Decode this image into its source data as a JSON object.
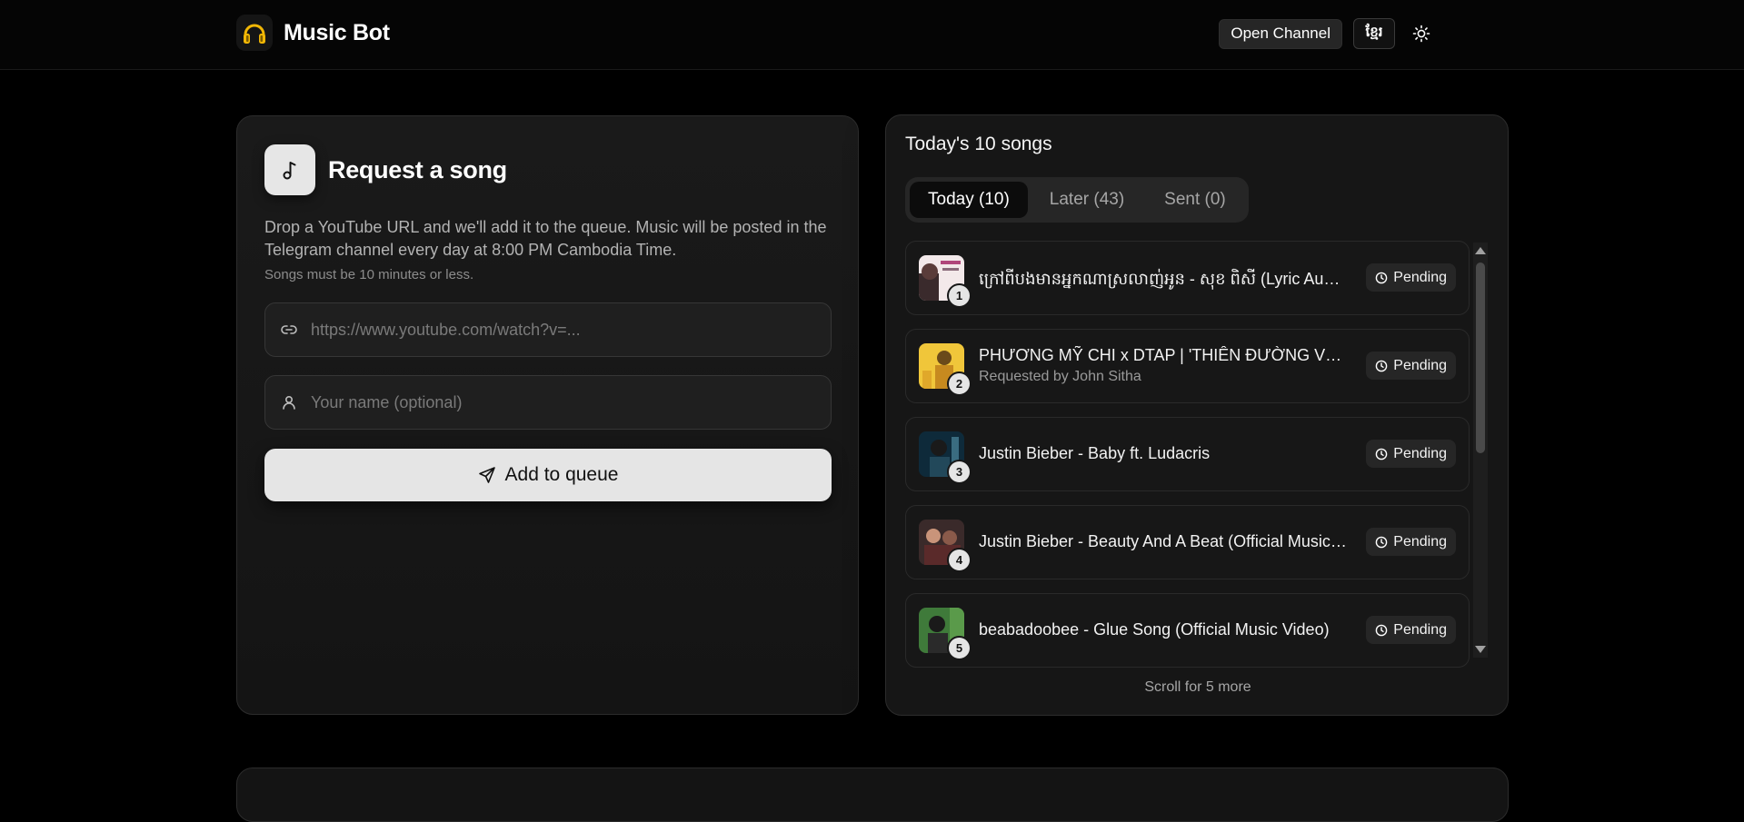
{
  "header": {
    "app_name": "Music Bot",
    "open_channel_label": "Open Channel",
    "language_label": "ខ្មែរ"
  },
  "request": {
    "title": "Request a song",
    "description": "Drop a YouTube URL and we'll add it to the queue. Music will be posted in the Telegram channel every day at 8:00 PM Cambodia Time.",
    "note": "Songs must be 10 minutes or less.",
    "url_placeholder": "https://www.youtube.com/watch?v=...",
    "name_placeholder": "Your name (optional)",
    "submit_label": "Add to queue"
  },
  "queue": {
    "title": "Today's 10 songs",
    "tabs": [
      {
        "label": "Today (10)",
        "active": true
      },
      {
        "label": "Later (43)",
        "active": false
      },
      {
        "label": "Sent (0)",
        "active": false
      }
    ],
    "songs": [
      {
        "num": "1",
        "title": "ក្រៅពីបងមានអ្នកណាស្រលាញ់អូន - សុខ ពិសី (Lyric Audio)",
        "requested_by": "",
        "status": "Pending"
      },
      {
        "num": "2",
        "title": "PHƯƠNG MỸ CHI x DTAP | 'THIÊN ĐƯỜNG VỚI EM'",
        "requested_by": "Requested by John Sitha",
        "status": "Pending"
      },
      {
        "num": "3",
        "title": "Justin Bieber - Baby ft. Ludacris",
        "requested_by": "",
        "status": "Pending"
      },
      {
        "num": "4",
        "title": "Justin Bieber - Beauty And A Beat (Official Music Video)",
        "requested_by": "",
        "status": "Pending"
      },
      {
        "num": "5",
        "title": "beabadoobee - Glue Song (Official Music Video)",
        "requested_by": "",
        "status": "Pending"
      }
    ],
    "more_label": "Scroll for 5 more"
  },
  "colors": {
    "background": "#000000",
    "card": "#161616",
    "accent_button": "#e5e5e5",
    "logo_yellow": "#f2b705"
  }
}
